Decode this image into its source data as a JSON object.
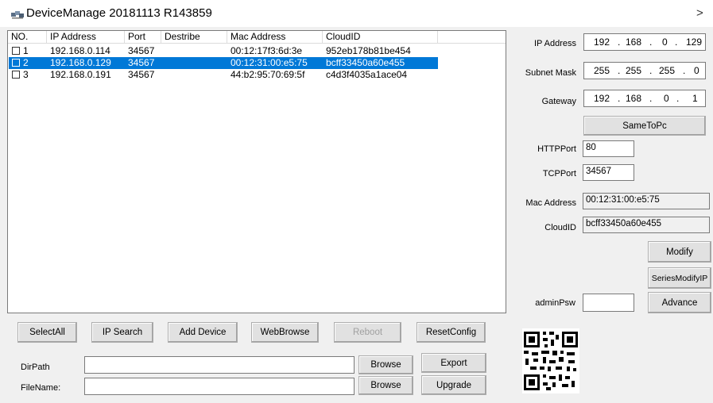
{
  "window": {
    "title": "DeviceManage 20181113 R143859",
    "close_glyph": ">",
    "app_icon": "network-devices-icon"
  },
  "device_list": {
    "columns": [
      "NO.",
      "IP Address",
      "Port",
      "Destribe",
      "Mac Address",
      "CloudID"
    ],
    "rows": [
      {
        "no": "1",
        "ip": "192.168.0.114",
        "port": "34567",
        "describe": "",
        "mac": "00:12:17f3:6d:3e",
        "cloudid": "952eb178b81be454",
        "selected": false
      },
      {
        "no": "2",
        "ip": "192.168.0.129",
        "port": "34567",
        "describe": "",
        "mac": "00:12:31:00:e5:75",
        "cloudid": "bcff33450a60e455",
        "selected": true
      },
      {
        "no": "3",
        "ip": "192.168.0.191",
        "port": "34567",
        "describe": "",
        "mac": "44:b2:95:70:69:5f",
        "cloudid": "c4d3f4035a1ace04",
        "selected": false
      }
    ]
  },
  "settings": {
    "ip_label": "IP Address",
    "ip_octets": [
      "192",
      "168",
      "0",
      "129"
    ],
    "subnet_label": "Subnet Mask",
    "subnet_octets": [
      "255",
      "255",
      "255",
      "0"
    ],
    "gateway_label": "Gateway",
    "gateway_octets": [
      "192",
      "168",
      "0",
      "1"
    ],
    "same_to_pc": "SameToPc",
    "http_label": "HTTPPort",
    "http_value": "80",
    "tcp_label": "TCPPort",
    "tcp_value": "34567",
    "mac_label": "Mac Address",
    "mac_value": "00:12:31:00:e5:75",
    "cloud_label": "CloudID",
    "cloud_value": "bcff33450a60e455",
    "modify": "Modify",
    "series_modify": "SeriesModifyIP",
    "admin_label": "adminPsw",
    "admin_value": "",
    "advance": "Advance",
    "ip_dot": "."
  },
  "toolbar": {
    "select_all": "SelectAll",
    "ip_search": "IP Search",
    "add_device": "Add Device",
    "web_browse": "WebBrowse",
    "reboot": "Reboot",
    "reset_config": "ResetConfig"
  },
  "paths": {
    "dirpath_label": "DirPath",
    "dirpath_value": "",
    "filename_label": "FileName:",
    "filename_value": "",
    "browse1": "Browse",
    "export": "Export",
    "browse2": "Browse",
    "upgrade": "Upgrade"
  },
  "qr": {
    "icon": "qr-code-icon"
  }
}
